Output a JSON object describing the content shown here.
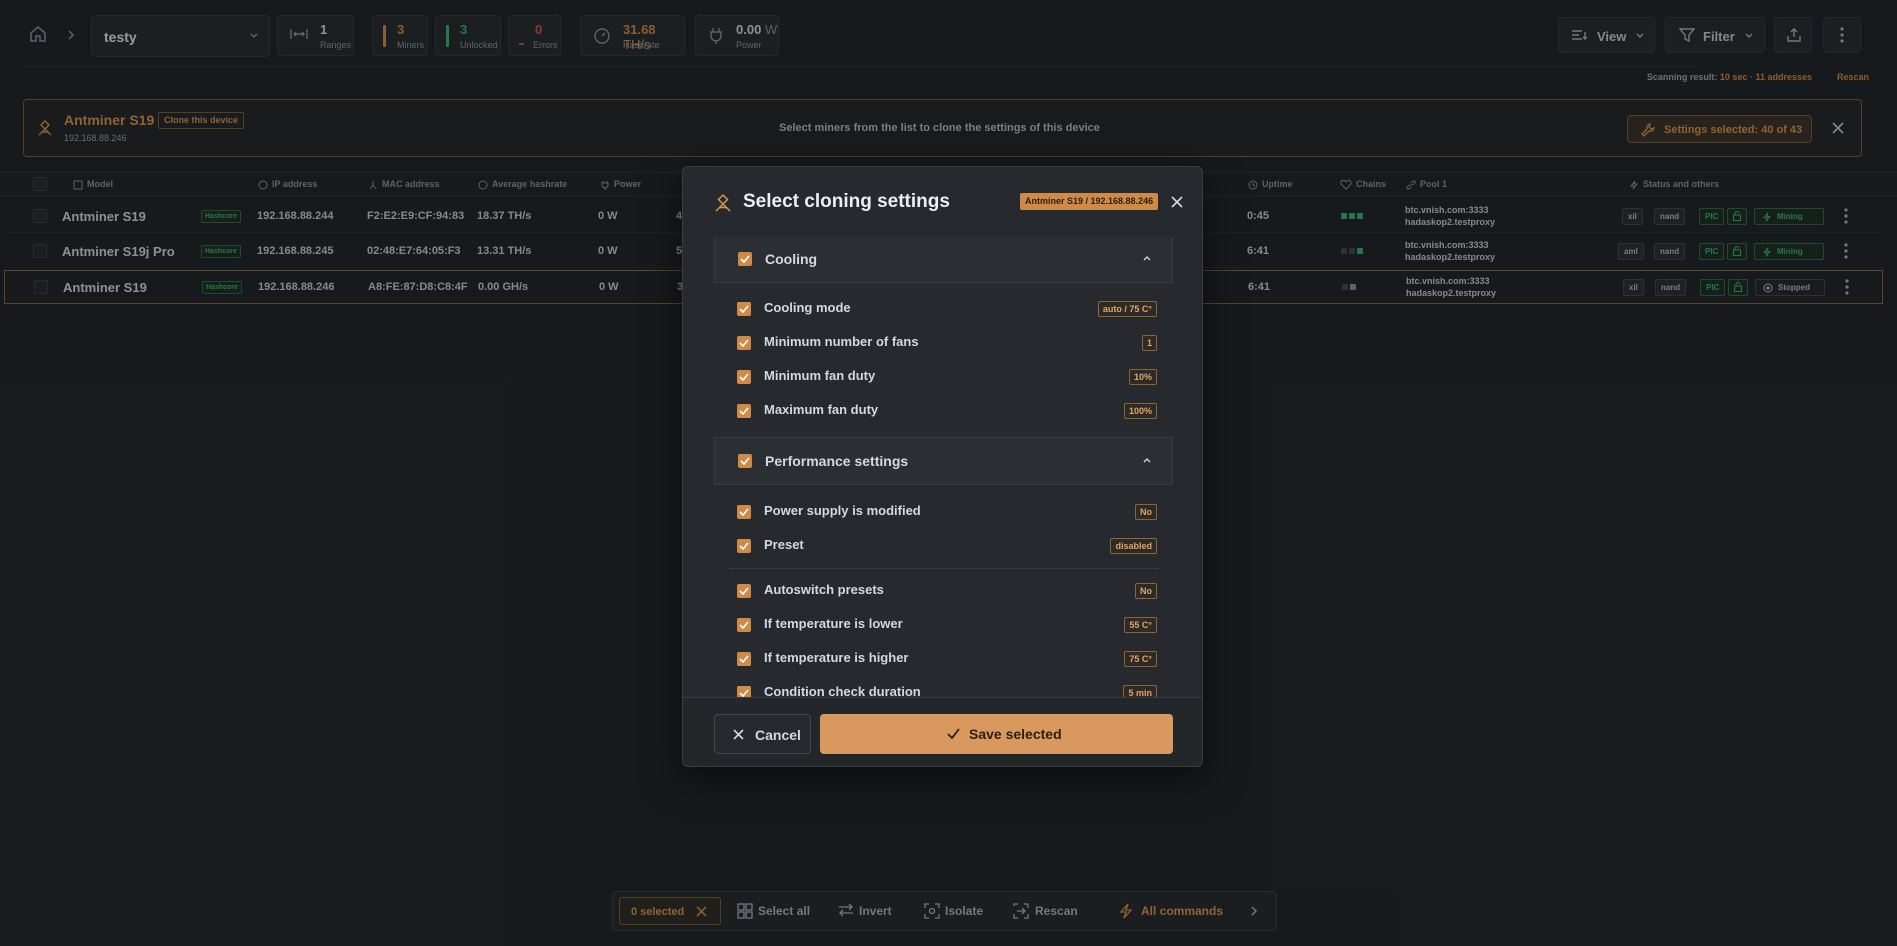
{
  "topbar": {
    "workspace": "testy",
    "stats": [
      {
        "value": "1",
        "label": "Ranges"
      },
      {
        "value": "3",
        "label": "Miners"
      },
      {
        "value": "3",
        "label": "Unlocked"
      },
      {
        "value": "0",
        "label": "Errors"
      },
      {
        "value": "31.68",
        "unit": "TH/s",
        "label": "Hashrate"
      },
      {
        "value": "0.00",
        "unit": "W",
        "label": "Power"
      }
    ],
    "view_label": "View",
    "filter_label": "Filter",
    "scanning_label": "Scanning result:",
    "scanning_value": "10 sec · 11 addresses",
    "rescan_label": "Rescan"
  },
  "banner": {
    "device_name": "Antminer S19",
    "clone_label": "Clone this device",
    "device_ip": "192.168.88.246",
    "message": "Select miners from the list to clone the settings of this device",
    "settings_selected": "Settings selected: 40 of 43"
  },
  "table": {
    "headers": [
      "Model",
      "IP address",
      "MAC address",
      "Average hashrate",
      "Power",
      "Uptime",
      "Chains",
      "Pool 1",
      "Status and others"
    ],
    "rows": [
      {
        "model": "Antminer S19",
        "tag": "Hashcore",
        "ip": "192.168.88.244",
        "mac": "F2:E2:E9:CF:94:83",
        "hashrate": "18.37 TH/s",
        "power": "0 W",
        "extra": "4",
        "uptime": "0:45",
        "pool_url": "btc.vnish.com:3333",
        "pool_user": "hadaskop2.testproxy",
        "fw": "xil",
        "storage": "nand",
        "pic": "PIC",
        "status": "Mining"
      },
      {
        "model": "Antminer S19j Pro",
        "tag": "Hashcore",
        "ip": "192.168.88.245",
        "mac": "02:48:E7:64:05:F3",
        "hashrate": "13.31 TH/s",
        "power": "0 W",
        "extra": "5",
        "uptime": "6:41",
        "pool_url": "btc.vnish.com:3333",
        "pool_user": "hadaskop2.testproxy",
        "fw": "aml",
        "storage": "nand",
        "pic": "PIC",
        "status": "Mining"
      },
      {
        "model": "Antminer S19",
        "tag": "Hashcore",
        "ip": "192.168.88.246",
        "mac": "A8:FE:87:D8:C8:4F",
        "hashrate": "0.00 GH/s",
        "power": "0 W",
        "extra": "3",
        "uptime": "6:41",
        "pool_url": "btc.vnish.com:3333",
        "pool_user": "hadaskop2.testproxy",
        "fw": "xil",
        "storage": "nand",
        "pic": "PIC",
        "status": "Stopped"
      }
    ]
  },
  "modal": {
    "title": "Select cloning settings",
    "device_tag": "Antminer S19 / 192.168.88.246",
    "sections": [
      {
        "title": "Cooling",
        "items": [
          {
            "label": "Cooling mode",
            "value": "auto / 75 C°"
          },
          {
            "label": "Minimum number of fans",
            "value": "1"
          },
          {
            "label": "Minimum fan duty",
            "value": "10%"
          },
          {
            "label": "Maximum fan duty",
            "value": "100%"
          }
        ]
      },
      {
        "title": "Performance settings",
        "items": [
          {
            "label": "Power supply is modified",
            "value": "No"
          },
          {
            "label": "Preset",
            "value": "disabled"
          },
          {
            "label": "Autoswitch presets",
            "value": "No"
          },
          {
            "label": "If temperature is lower",
            "value": "55 C°"
          },
          {
            "label": "If temperature is higher",
            "value": "75 C°"
          },
          {
            "label": "Condition check duration",
            "value": "5 min"
          }
        ]
      }
    ],
    "cancel_label": "Cancel",
    "save_label": "Save selected"
  },
  "actionbar": {
    "selected": "0 selected",
    "select_all": "Select all",
    "invert": "Invert",
    "isolate": "Isolate",
    "rescan": "Rescan",
    "all_commands": "All commands"
  },
  "colors": {
    "accent": "#d08a48",
    "success": "#3bb069",
    "error": "#d0534d",
    "bg": "#1f2225"
  }
}
